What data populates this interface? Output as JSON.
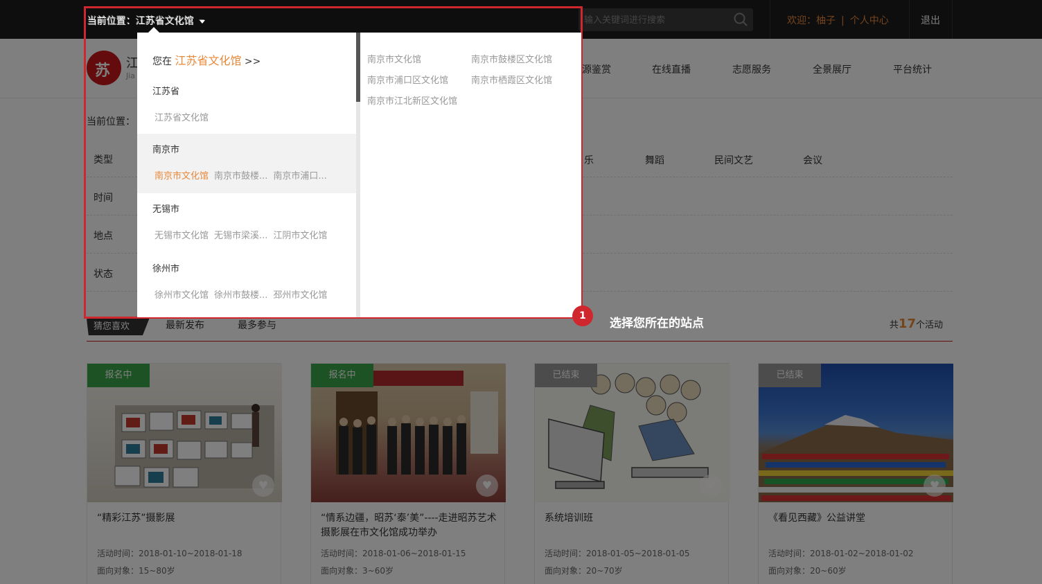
{
  "topbar": {
    "location_label": "当前位置：",
    "location_value": "江苏省文化馆",
    "search_placeholder": "输入关键词进行搜索",
    "welcome": "欢迎：柚子",
    "separator": "|",
    "user_center": "个人中心",
    "logout": "退出"
  },
  "header": {
    "logo_char": "苏",
    "logo_title": "江",
    "logo_sub": "Jia",
    "nav": [
      "源鉴赏",
      "在线直播",
      "志愿服务",
      "全景展厅",
      "平台统计"
    ]
  },
  "filters": {
    "breadcrumb": "当前位置：",
    "rows": [
      "类型",
      "时间",
      "地点",
      "状态"
    ],
    "type_options": [
      "乐",
      "舞蹈",
      "民间文艺",
      "会议"
    ]
  },
  "tabs": {
    "hot": "猜您喜欢",
    "items": [
      "最新发布",
      "最多参与"
    ],
    "total_prefix": "共",
    "total_count": "17",
    "total_suffix": "个活动"
  },
  "cards": [
    {
      "badge": "报名中",
      "title": "“精彩江苏”摄影展",
      "time": "活动时间：2018-01-10~2018-01-18",
      "audience": "面向对象：15~80岁"
    },
    {
      "badge": "报名中",
      "title": "“情系边疆，昭苏‘泰’美”----走进昭苏艺术摄影展在市文化馆成功举办",
      "time": "活动时间：2018-01-06~2018-01-15",
      "audience": "面向对象：3~60岁"
    },
    {
      "badge": "已结束",
      "title": "系统培训班",
      "time": "活动时间：2018-01-05~2018-01-05",
      "audience": "面向对象：20~70岁"
    },
    {
      "badge": "已结束",
      "title": "《看见西藏》公益讲堂",
      "time": "活动时间：2018-01-02~2018-01-02",
      "audience": "面向对象：20~60岁"
    }
  ],
  "colors": {
    "accent": "#e8883a",
    "brand": "#c8161d",
    "badge_open": "#3aa54a",
    "badge_closed": "#999999",
    "highlight_border": "#d0272f"
  },
  "dropdown": {
    "you_at_prefix": "您在",
    "you_at_value": "江苏省文化馆",
    "you_at_suffix": ">>",
    "groups": [
      {
        "name": "江苏省",
        "items": [
          "江苏省文化馆"
        ]
      },
      {
        "name": "南京市",
        "items": [
          "南京市文化馆",
          "南京市鼓楼...",
          "南京市浦口..."
        ]
      },
      {
        "name": "无锡市",
        "items": [
          "无锡市文化馆",
          "无锡市梁溪...",
          "江阴市文化馆"
        ]
      },
      {
        "name": "徐州市",
        "items": [
          "徐州市文化馆",
          "徐州市鼓楼...",
          "邳州市文化馆"
        ]
      }
    ],
    "sub_items": [
      "南京市文化馆",
      "南京市鼓楼区文化馆",
      "南京市浦口区文化馆",
      "南京市栖霞区文化馆",
      "南京市江北新区文化馆"
    ]
  },
  "annotation": {
    "marker": "1",
    "label": "选择您所在的站点"
  }
}
